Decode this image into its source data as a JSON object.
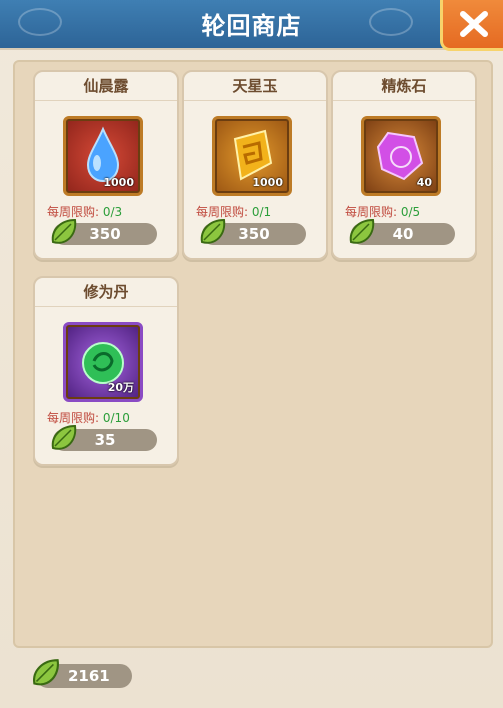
{
  "title": "轮回商店",
  "items": [
    {
      "name": "仙晨露",
      "qty": "1000",
      "limit_label": "每周限购:",
      "limit_value": "0/3",
      "price": "350",
      "icon": "water-drop-icon",
      "color": "#b8382c"
    },
    {
      "name": "天星玉",
      "qty": "1000",
      "limit_label": "每周限购:",
      "limit_value": "0/1",
      "price": "350",
      "icon": "jade-icon",
      "color": "#c27a1e"
    },
    {
      "name": "精炼石",
      "qty": "40",
      "limit_label": "每周限购:",
      "limit_value": "0/5",
      "price": "40",
      "icon": "gem-icon",
      "color": "#b56b1f"
    },
    {
      "name": "修为丹",
      "qty": "20万",
      "limit_label": "每周限购:",
      "limit_value": "0/10",
      "price": "35",
      "icon": "pill-icon",
      "color": "#7c3bb0"
    }
  ],
  "balance": "2161"
}
